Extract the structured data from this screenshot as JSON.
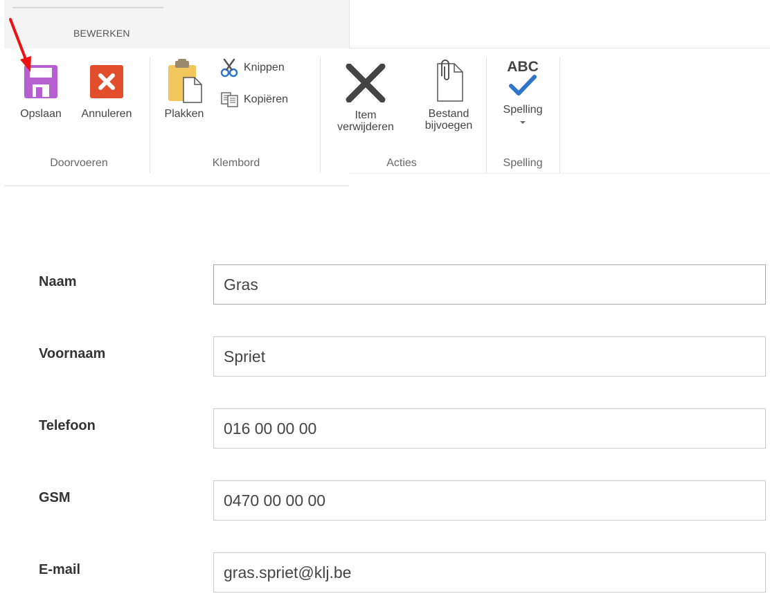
{
  "ribbon": {
    "tab_label": "BEWERKEN",
    "groups": {
      "doorvoeren": {
        "label": "Doorvoeren",
        "save_label": "Opslaan",
        "cancel_label": "Annuleren"
      },
      "klembord": {
        "label": "Klembord",
        "paste_label": "Plakken",
        "cut_label": "Knippen",
        "copy_label": "Kopiëren"
      },
      "acties": {
        "label": "Acties",
        "delete_item_line1": "Item",
        "delete_item_line2": "verwijderen",
        "attach_file_line1": "Bestand",
        "attach_file_line2": "bijvoegen"
      },
      "spelling": {
        "label": "Spelling",
        "spelling_label": "Spelling",
        "abc_text": "ABC"
      }
    }
  },
  "form": {
    "fields": [
      {
        "label": "Naam",
        "value": "Gras"
      },
      {
        "label": "Voornaam",
        "value": "Spriet"
      },
      {
        "label": "Telefoon",
        "value": "016 00 00 00"
      },
      {
        "label": "GSM",
        "value": "0470 00 00 00"
      },
      {
        "label": "E-mail",
        "value": "gras.spriet@klj.be"
      }
    ]
  },
  "colors": {
    "save_icon": "#b55fd0",
    "cancel_icon": "#e24e2c",
    "spell_check": "#2e74c9",
    "annotation_arrow": "#ee1111"
  },
  "icons": {
    "save": "floppy-disk-icon",
    "cancel": "close-x-icon",
    "paste": "clipboard-icon",
    "cut": "scissors-icon",
    "copy": "copy-icon",
    "delete_item": "big-x-icon",
    "attach": "paperclip-file-icon",
    "spelling": "abc-check-icon"
  }
}
